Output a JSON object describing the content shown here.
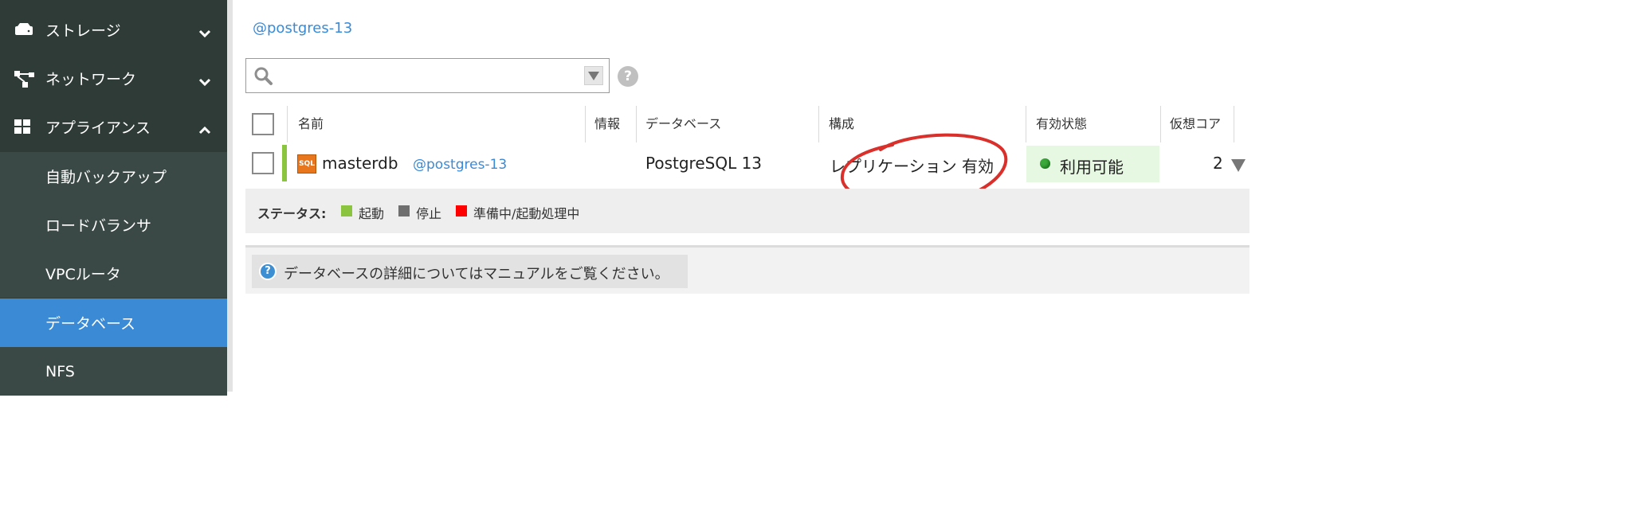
{
  "sidebar": {
    "items": [
      {
        "label": "ストレージ",
        "icon": "storage-icon",
        "chevron": "down"
      },
      {
        "label": "ネットワーク",
        "icon": "network-icon",
        "chevron": "down"
      },
      {
        "label": "アプライアンス",
        "icon": "appliance-icon",
        "chevron": "up"
      }
    ],
    "subitems": [
      {
        "label": "自動バックアップ"
      },
      {
        "label": "ロードバランサ"
      },
      {
        "label": "VPCルータ"
      },
      {
        "label": "データベース",
        "active": true
      },
      {
        "label": "NFS"
      }
    ]
  },
  "breadcrumb": "@postgres-13",
  "search": {
    "value": "",
    "placeholder": ""
  },
  "table": {
    "headers": {
      "name": "名前",
      "info": "情報",
      "database": "データベース",
      "config": "構成",
      "availability": "有効状態",
      "vcores": "仮想コア"
    },
    "rows": [
      {
        "name": "masterdb",
        "tag": "@postgres-13",
        "icon_text": "SQL",
        "database": "PostgreSQL 13",
        "config": "レプリケーション 有効",
        "availability": "利用可能",
        "vcores": "2"
      }
    ]
  },
  "status_legend": {
    "label": "ステータス:",
    "items": [
      {
        "label": "起動",
        "color": "#8bc53f"
      },
      {
        "label": "停止",
        "color": "#6f6f6f"
      },
      {
        "label": "準備中/起動処理中",
        "color": "#ff0000"
      }
    ]
  },
  "info_message": "データベースの詳細についてはマニュアルをご覧ください。",
  "help_glyph": "?",
  "colors": {
    "sidebar_bg": "#2e3b37",
    "active_item": "#3a8ad6",
    "link": "#3a8ad6",
    "annotation": "#d9302c"
  }
}
